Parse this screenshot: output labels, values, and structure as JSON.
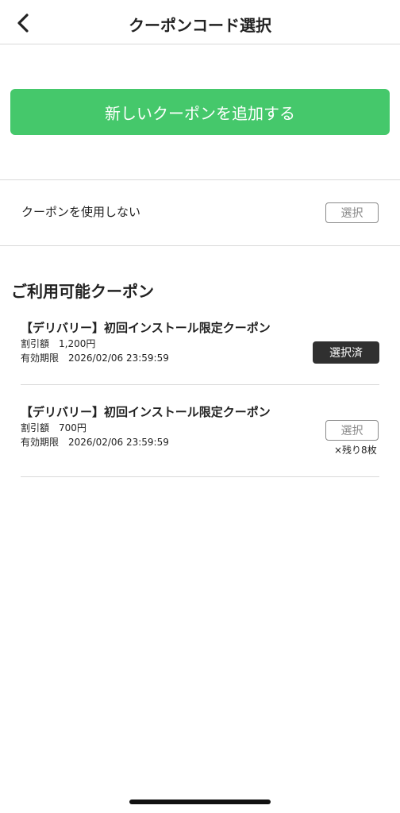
{
  "header": {
    "title": "クーポンコード選択",
    "back_icon": "chevron-left-icon"
  },
  "add_button": {
    "label": "新しいクーポンを追加する",
    "color": "#45c86b"
  },
  "no_coupon": {
    "label": "クーポンを使用しない",
    "select_label": "選択"
  },
  "available": {
    "title": "ご利用可能クーポン",
    "coupons": [
      {
        "name": "【デリバリー】初回インストール限定クーポン",
        "discount": "割引額　1,200円",
        "expiry": "有効期限　2026/02/06 23:59:59",
        "button_label": "選択済",
        "selected": true
      },
      {
        "name": "【デリバリー】初回インストール限定クーポン",
        "discount": "割引額　700円",
        "expiry": "有効期限　2026/02/06 23:59:59",
        "button_label": "選択",
        "remaining": "×残り8枚",
        "selected": false
      }
    ]
  }
}
